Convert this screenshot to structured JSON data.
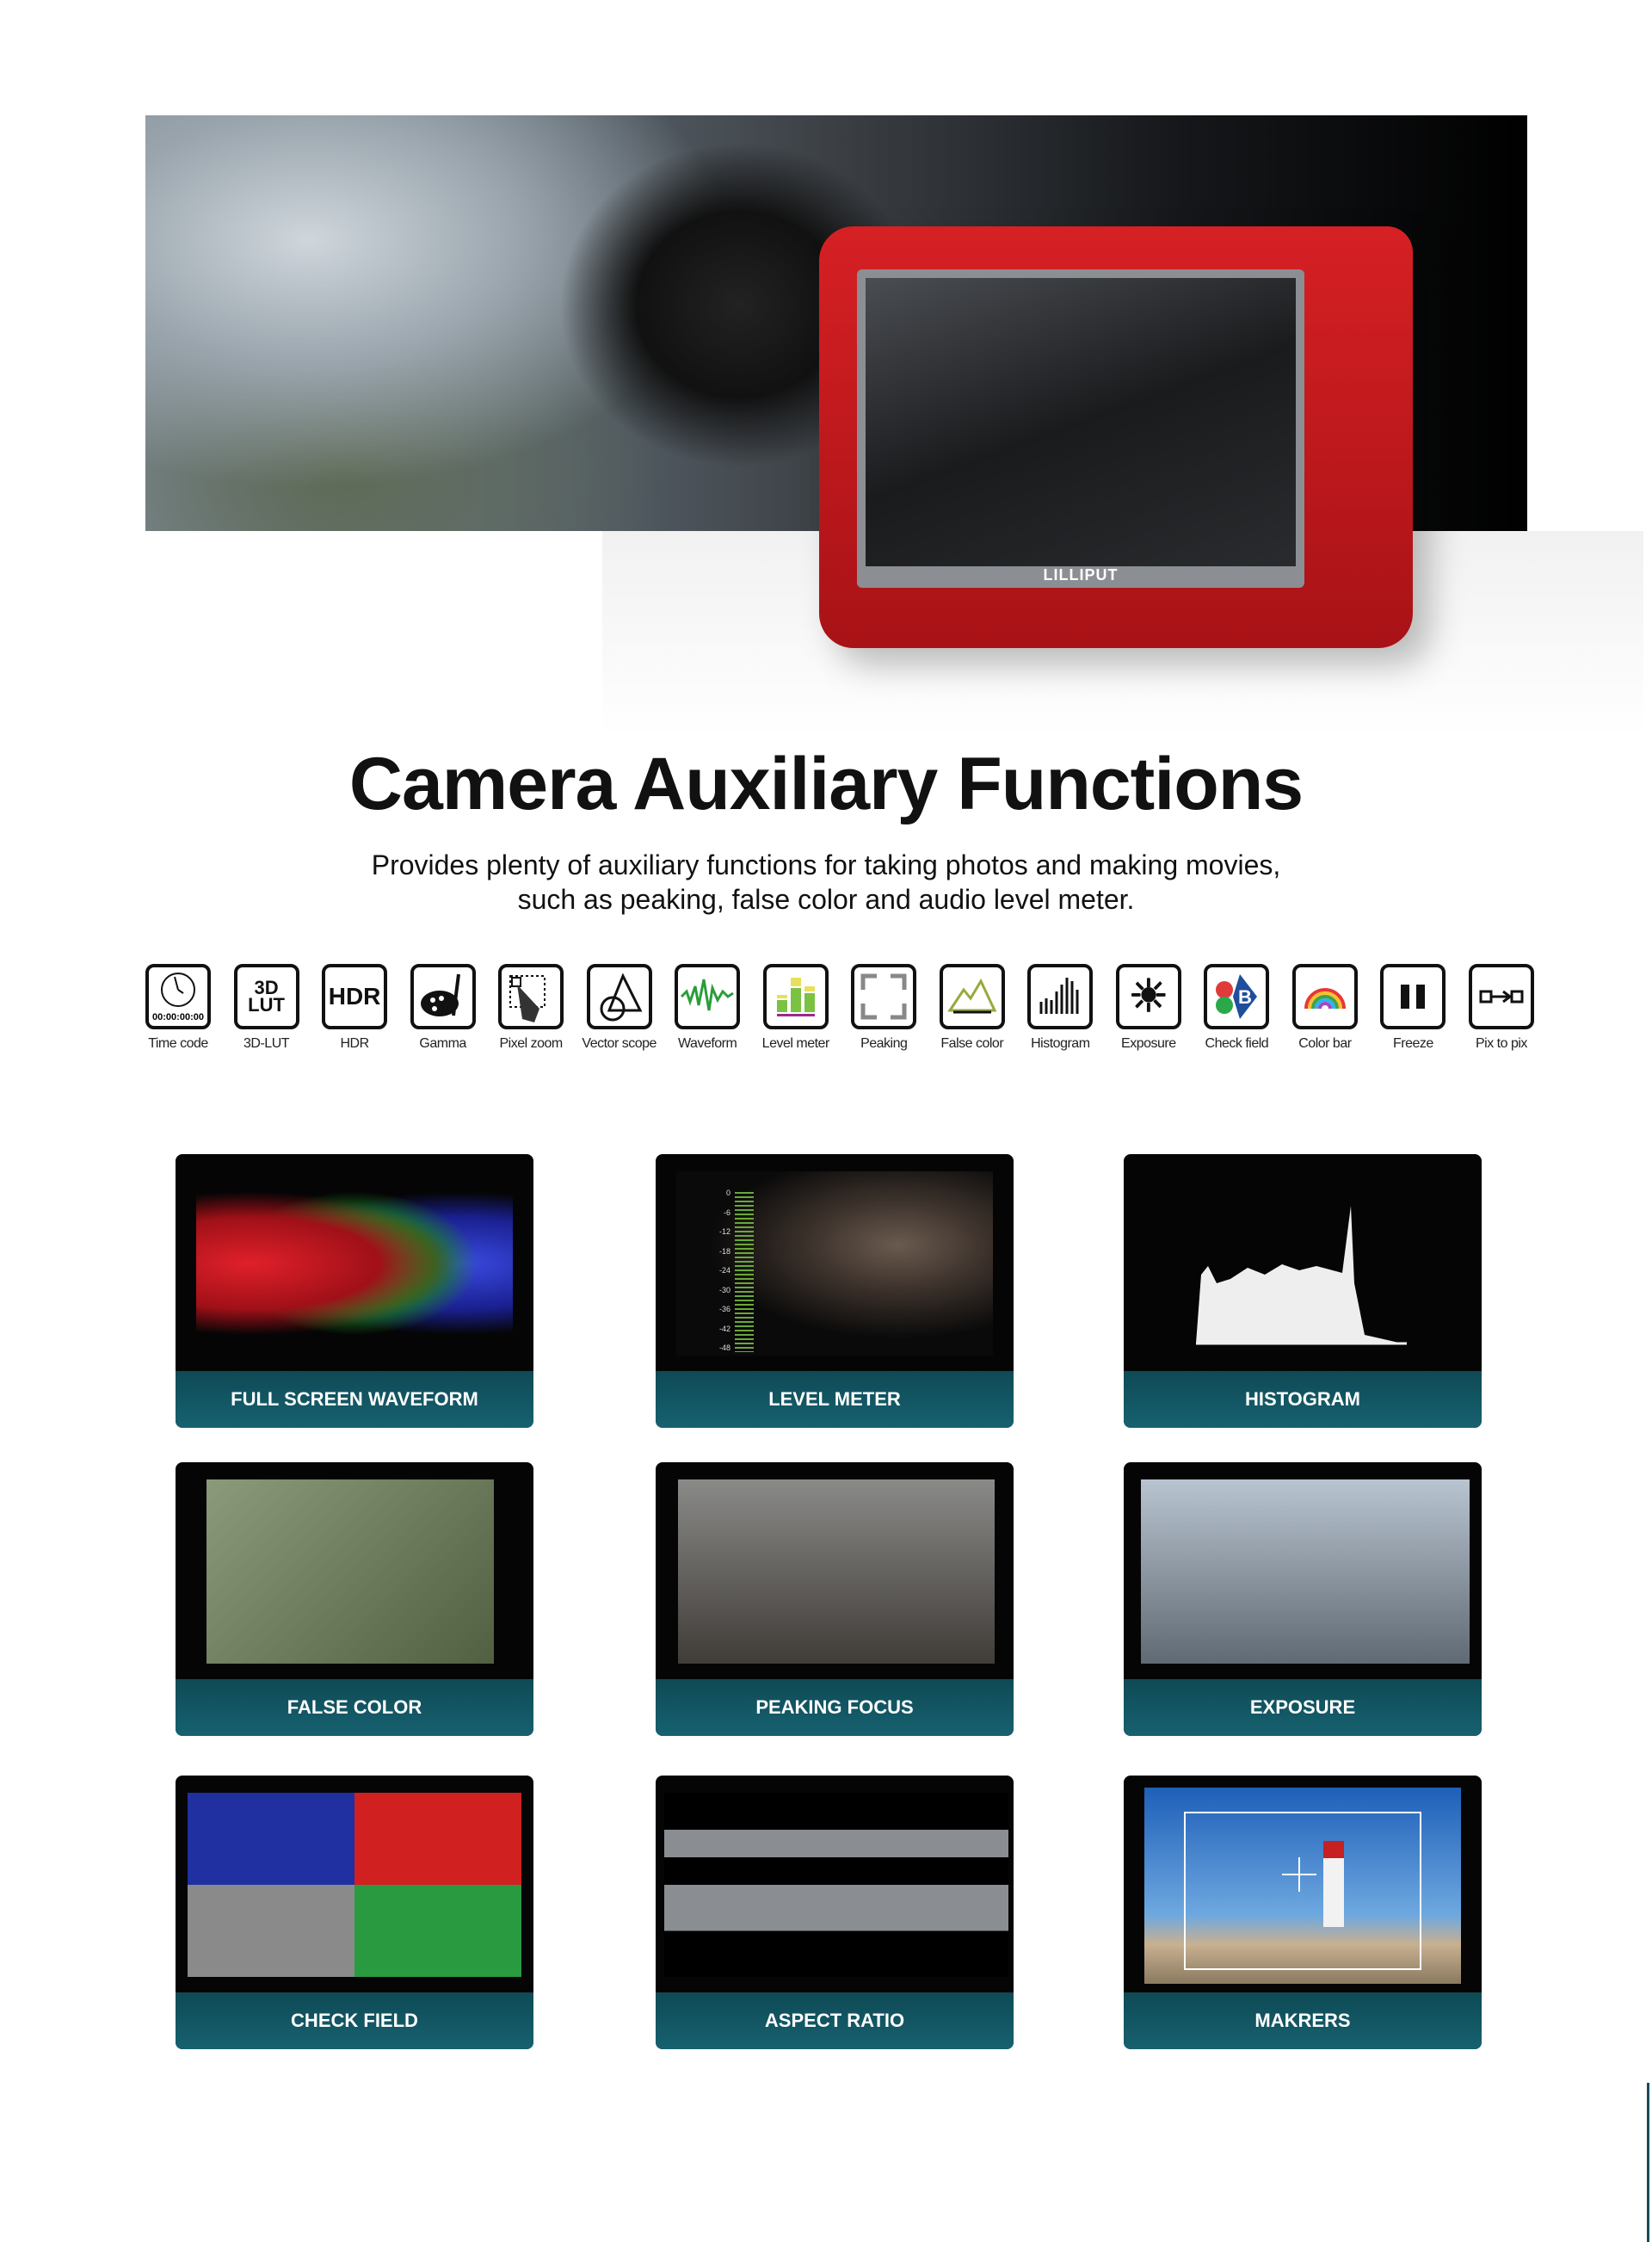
{
  "hero": {
    "brand": "LILLIPUT"
  },
  "title": "Camera Auxiliary Functions",
  "subtitle": [
    "Provides plenty of auxiliary functions for taking photos and making movies,",
    "such as peaking, false color and audio level meter."
  ],
  "functions": [
    {
      "label": "Time code",
      "icon": "clock-icon",
      "text": "00:00:00:00"
    },
    {
      "label": "3D-LUT",
      "icon": "3d-lut-icon",
      "text": "3D LUT"
    },
    {
      "label": "HDR",
      "icon": "hdr-icon",
      "text": "HDR"
    },
    {
      "label": "Gamma",
      "icon": "palette-icon"
    },
    {
      "label": "Pixel zoom",
      "icon": "pixel-zoom-icon"
    },
    {
      "label": "Vector scope",
      "icon": "vector-scope-icon"
    },
    {
      "label": "Waveform",
      "icon": "waveform-icon"
    },
    {
      "label": "Level meter",
      "icon": "level-meter-icon"
    },
    {
      "label": "Peaking",
      "icon": "peaking-icon"
    },
    {
      "label": "False color",
      "icon": "mountain-icon"
    },
    {
      "label": "Histogram",
      "icon": "histogram-icon"
    },
    {
      "label": "Exposure",
      "icon": "sun-icon"
    },
    {
      "label": "Check field",
      "icon": "rgb-icon"
    },
    {
      "label": "Color bar",
      "icon": "rainbow-icon"
    },
    {
      "label": "Freeze",
      "icon": "pause-icon"
    },
    {
      "label": "Pix to pix",
      "icon": "pix-to-pix-icon"
    }
  ],
  "level_meter_ticks": [
    "0",
    "-6",
    "-12",
    "-18",
    "-24",
    "-30",
    "-36",
    "-42",
    "-48"
  ],
  "cards": [
    {
      "caption": "FULL SCREEN WAVEFORM"
    },
    {
      "caption": "LEVEL METER"
    },
    {
      "caption": "HISTOGRAM"
    },
    {
      "caption": "FALSE COLOR"
    },
    {
      "caption": "PEAKING FOCUS"
    },
    {
      "caption": "EXPOSURE"
    },
    {
      "caption": "CHECK FIELD"
    },
    {
      "caption": "ASPECT RATIO"
    },
    {
      "caption": "MAKRERS"
    }
  ],
  "colors": {
    "monitor_red": "#d62024",
    "caption_teal": "#176170"
  }
}
